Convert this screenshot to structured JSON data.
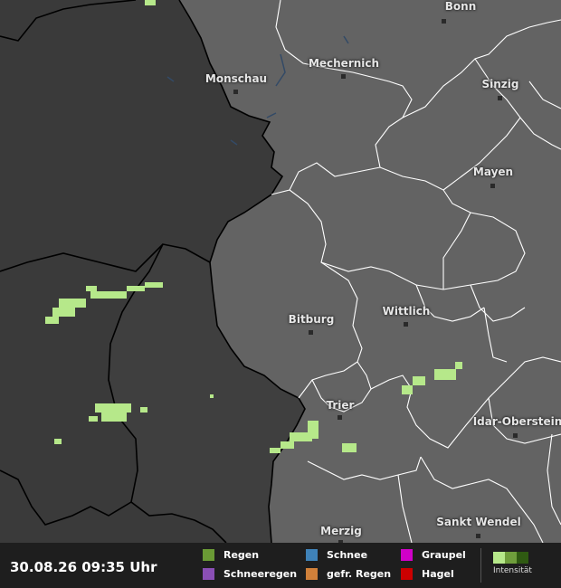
{
  "timestamp": "30.08.26 09:35 Uhr",
  "cities": [
    {
      "id": "bonn",
      "name": "Bonn"
    },
    {
      "id": "mechernich",
      "name": "Mechernich"
    },
    {
      "id": "monschau",
      "name": "Monschau"
    },
    {
      "id": "sinzig",
      "name": "Sinzig"
    },
    {
      "id": "mayen",
      "name": "Mayen"
    },
    {
      "id": "bitburg",
      "name": "Bitburg"
    },
    {
      "id": "wittlich",
      "name": "Wittlich"
    },
    {
      "id": "trier",
      "name": "Trier"
    },
    {
      "id": "idar-oberstein",
      "name": "Idar-Oberstein"
    },
    {
      "id": "merzig",
      "name": "Merzig"
    },
    {
      "id": "sankt-wendel",
      "name": "Sankt Wendel"
    }
  ],
  "legend": {
    "items": [
      {
        "label": "Regen",
        "color": "#6a9a35"
      },
      {
        "label": "Schneeregen",
        "color": "#8a4fb5"
      },
      {
        "label": "Schnee",
        "color": "#3f82b8"
      },
      {
        "label": "gefr. Regen",
        "color": "#d0803a"
      },
      {
        "label": "Graupel",
        "color": "#d000c8"
      },
      {
        "label": "Hagel",
        "color": "#cc0000"
      }
    ],
    "intensity_label": "Intensität",
    "intensity_colors": [
      "#b6e88a",
      "#6f9e3c",
      "#2f5a12"
    ]
  },
  "colors": {
    "background_outside": "#3a3a3a",
    "land_germany": "#636363",
    "national_border": "#000000",
    "state_border": "#ffffff",
    "rain_light": "#b6e88a"
  }
}
